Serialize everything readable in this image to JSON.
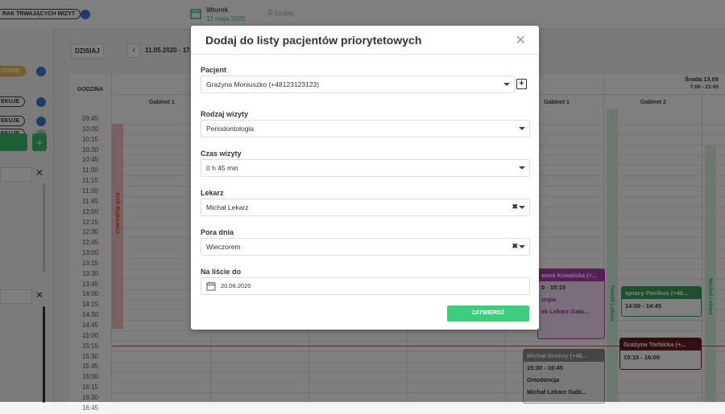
{
  "topbar": {
    "trwajace_label": "RAK TRWAJĄCYCH WIZYT",
    "date_day": "Wtorek",
    "date_full": "12 maja 2020",
    "search_placeholder": "Szukaj..."
  },
  "left_panel": {
    "statuses": [
      "ODWIE",
      "EKUJE",
      "EKUJE",
      "EKUJE"
    ]
  },
  "calendar": {
    "today_button": "DZISIAJ",
    "date_range": "11.05.2020 - 17.",
    "time_header": "GODZINA",
    "day_right": "Środa 13.05",
    "day_right_hours": "7:00 - 21:00",
    "cabinets": [
      "Gabinet 1",
      "Gabinet 1",
      "Gabinet 2"
    ],
    "times": [
      "09:45",
      "10:00",
      "10:15",
      "10:30",
      "10:45",
      "11:00",
      "11:15",
      "11:30",
      "11:45",
      "12:00",
      "12:15",
      "12:30",
      "12:45",
      "13:00",
      "13:15",
      "13:30",
      "13:45",
      "14:00",
      "14:15",
      "14:30",
      "14:45",
      "15:00",
      "15:15",
      "15:30",
      "15:45",
      "16:00",
      "16:15",
      "16:30",
      "16:45"
    ],
    "doctor_columns": [
      "Arek Bujkowicz",
      "Tomek Lekarz",
      "Michał Lekarz"
    ],
    "appointments": [
      {
        "name": "anna Kowalska (+...",
        "time": "0 - 15:15",
        "type": "urgia",
        "doctor": "ek Lekarz Gabi..."
      },
      {
        "name": "Ignacy Pasibus (+48...",
        "time": "14:00 - 14:45"
      },
      {
        "name": "Grażyna Torbicka (+...",
        "time": "15:15 - 16:00"
      },
      {
        "name": "Michał Groźny (+48...",
        "time": "15:30 - 16:45",
        "type": "Ortodoncja",
        "doctor": "Michał Lekarz Gabi..."
      }
    ]
  },
  "modal": {
    "title": "Dodaj do listy pacjentów priorytetowych",
    "patient_label": "Pacjent",
    "patient_value": "Grażyna Moniuszko (+48123123123)",
    "visit_type_label": "Rodzaj wizyty",
    "visit_type_value": "Periodontologia",
    "duration_label": "Czas wizyty",
    "duration_value": "0 h 45 min",
    "doctor_label": "Lekarz",
    "doctor_value": "Michał Lekarz",
    "timeofday_label": "Pora dnia",
    "timeofday_value": "Wieczorem",
    "onlist_label": "Na liście do",
    "onlist_value": "20.06.2020",
    "submit_label": "ZATWIERDŹ"
  }
}
